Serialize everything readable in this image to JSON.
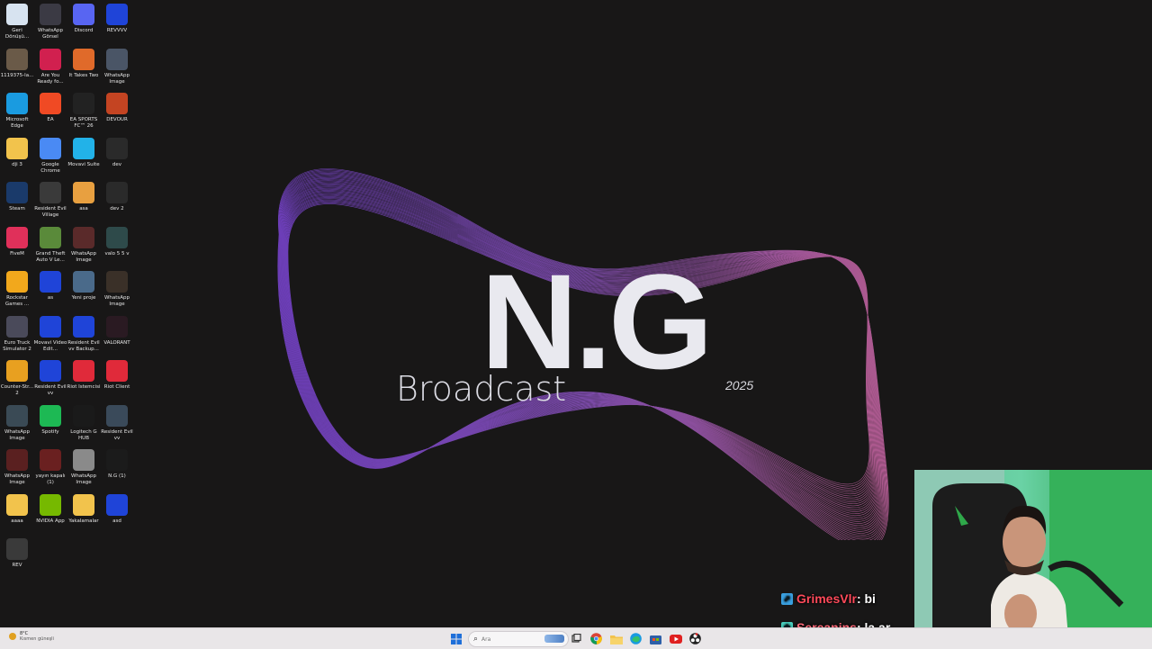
{
  "desktop": {
    "icons": [
      {
        "label": "Geri Dönüşü...",
        "icon": "recycle-bin-icon",
        "color": "#d7e3f0"
      },
      {
        "label": "WhatsApp Görsel 2025...",
        "icon": "image-thumbnail-icon",
        "color": "#3b3a44"
      },
      {
        "label": "Discord",
        "icon": "discord-icon",
        "color": "#5865f2"
      },
      {
        "label": "REVVVV",
        "icon": "app-icon",
        "color": "#1f44d8"
      },
      {
        "label": "1119375-la...",
        "icon": "image-thumbnail-icon",
        "color": "#6a5a48"
      },
      {
        "label": "Are You Ready fo...",
        "icon": "app-icon",
        "color": "#d1204f"
      },
      {
        "label": "It Takes Two",
        "icon": "game-icon",
        "color": "#e06a2a"
      },
      {
        "label": "WhatsApp Image 2026...",
        "icon": "image-thumbnail-icon",
        "color": "#4a5566"
      },
      {
        "label": "Microsoft Edge",
        "icon": "edge-icon",
        "color": "#1a9be0"
      },
      {
        "label": "EA",
        "icon": "ea-icon",
        "color": "#f04a24"
      },
      {
        "label": "EA SPORTS FC™ 26",
        "icon": "game-icon",
        "color": "#222222"
      },
      {
        "label": "DEVOUR",
        "icon": "game-icon",
        "color": "#c44422"
      },
      {
        "label": "dji 3",
        "icon": "folder-icon",
        "color": "#f2c34c"
      },
      {
        "label": "Google Chrome",
        "icon": "chrome-icon",
        "color": "#4a8af4"
      },
      {
        "label": "Movavi Suite",
        "icon": "app-icon",
        "color": "#22b2e8"
      },
      {
        "label": "dev",
        "icon": "video-file-icon",
        "color": "#2a2a2a"
      },
      {
        "label": "Steam",
        "icon": "steam-icon",
        "color": "#1a3a6a"
      },
      {
        "label": "Resident Evil Village",
        "icon": "game-icon",
        "color": "#3a3a3a"
      },
      {
        "label": "asa",
        "icon": "image-thumbnail-icon",
        "color": "#e8a040"
      },
      {
        "label": "dev 2",
        "icon": "video-file-icon",
        "color": "#2a2a2a"
      },
      {
        "label": "FiveM",
        "icon": "fivem-icon",
        "color": "#e0305a"
      },
      {
        "label": "Grand Theft Auto V Le...",
        "icon": "game-icon",
        "color": "#5a8a3a"
      },
      {
        "label": "WhatsApp Image 2026...",
        "icon": "image-thumbnail-icon",
        "color": "#5a2a2a"
      },
      {
        "label": "valo 5 5 v",
        "icon": "video-file-icon",
        "color": "#2e4a4a"
      },
      {
        "label": "Rockstar Games ...",
        "icon": "rockstar-icon",
        "color": "#f2a81c"
      },
      {
        "label": "as",
        "icon": "app-icon",
        "color": "#1f44d8"
      },
      {
        "label": "Yeni proje",
        "icon": "image-thumbnail-icon",
        "color": "#4a6a8a"
      },
      {
        "label": "WhatsApp Image 2025...",
        "icon": "image-thumbnail-icon",
        "color": "#3a3028"
      },
      {
        "label": "Euro Truck Simulator 2",
        "icon": "game-icon",
        "color": "#4a4a5a"
      },
      {
        "label": "Movavi Video Edit...",
        "icon": "app-icon",
        "color": "#1f44d8"
      },
      {
        "label": "Resident Evil vv Backup...",
        "icon": "app-icon",
        "color": "#1f44d8"
      },
      {
        "label": "VALORANT",
        "icon": "valorant-icon",
        "color": "#2a1a22"
      },
      {
        "label": "Counter-Str... 2",
        "icon": "game-icon",
        "color": "#e8a020"
      },
      {
        "label": "Resident Evil vv",
        "icon": "app-icon",
        "color": "#1f44d8"
      },
      {
        "label": "Riot İstemcisi",
        "icon": "riot-icon",
        "color": "#e02a3a"
      },
      {
        "label": "Riot Client",
        "icon": "riot-icon",
        "color": "#e02a3a"
      },
      {
        "label": "WhatsApp Image 2026...",
        "icon": "image-thumbnail-icon",
        "color": "#3a4a55"
      },
      {
        "label": "Spotify",
        "icon": "spotify-icon",
        "color": "#1db954"
      },
      {
        "label": "Logitech G HUB",
        "icon": "logitech-icon",
        "color": "#1a1a1a"
      },
      {
        "label": "Resident Evil vv",
        "icon": "video-file-icon",
        "color": "#3a4a5a"
      },
      {
        "label": "WhatsApp Image 2026...",
        "icon": "image-thumbnail-icon",
        "color": "#5a2020"
      },
      {
        "label": "yayın kapalı (1)",
        "icon": "image-thumbnail-icon",
        "color": "#6a2020"
      },
      {
        "label": "WhatsApp Image 2026...",
        "icon": "image-thumbnail-icon",
        "color": "#8a8a8a"
      },
      {
        "label": "N.G (1)",
        "icon": "file-icon",
        "color": "#1b1b1b"
      },
      {
        "label": "aaaa",
        "icon": "folder-icon",
        "color": "#f2c34c"
      },
      {
        "label": "NVIDIA App",
        "icon": "nvidia-icon",
        "color": "#76b900"
      },
      {
        "label": "Yakalamalar",
        "icon": "folder-icon",
        "color": "#f2c34c"
      },
      {
        "label": "asd",
        "icon": "app-icon",
        "color": "#1f44d8"
      },
      {
        "label": "REV",
        "icon": "video-file-icon",
        "color": "#3a3a3a"
      }
    ]
  },
  "wallpaper": {
    "logo": "N.G",
    "subtitle": "Broadcast",
    "year": "2025"
  },
  "chat": [
    {
      "user": "GrimesVlr",
      "text": ": bi",
      "color": "#ff4a5a",
      "badge": "verified-badge-icon"
    },
    {
      "user": "Sereanins",
      "text": ": la ar",
      "color": "#ff6a7a",
      "badge": "subscriber-badge-icon"
    }
  ],
  "taskbar": {
    "weather_temp": "8°C",
    "weather_desc": "Kısmen güneşli",
    "search_placeholder": "Ara",
    "items": [
      {
        "icon": "windows-start-icon",
        "color": "#1e6fd9"
      },
      {
        "icon": "task-view-icon",
        "color": "#444444"
      },
      {
        "icon": "chrome-icon",
        "color": "#4a8af4"
      },
      {
        "icon": "file-explorer-icon",
        "color": "#f2c34c"
      },
      {
        "icon": "edge-icon",
        "color": "#1a9be0"
      },
      {
        "icon": "store-icon",
        "color": "#2d5fa8"
      },
      {
        "icon": "youtube-icon",
        "color": "#e02020"
      },
      {
        "icon": "obs-icon",
        "color": "#202020"
      }
    ]
  }
}
